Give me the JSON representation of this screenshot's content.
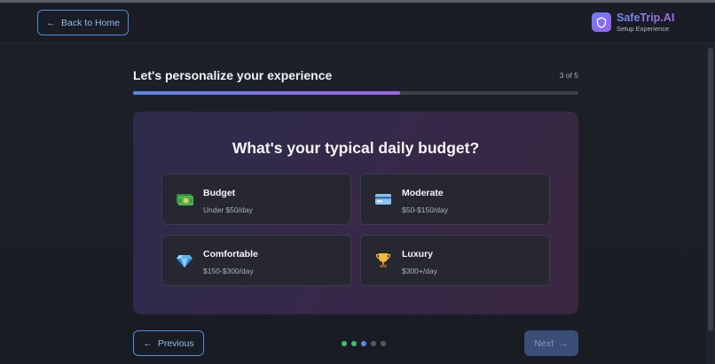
{
  "header": {
    "back_label": "Back to Home",
    "brand_name": "SafeTrip.AI",
    "brand_subtitle": "Setup Experience"
  },
  "wizard": {
    "title": "Let's personalize your experience",
    "step_text": "3 of 5",
    "progress_fraction": 0.6,
    "question": "What's your typical daily budget?",
    "options": [
      {
        "label": "Budget",
        "desc": "Under $50/day",
        "icon": "money-icon"
      },
      {
        "label": "Moderate",
        "desc": "$50-$150/day",
        "icon": "credit-card-icon"
      },
      {
        "label": "Comfortable",
        "desc": "$150-$300/day",
        "icon": "diamond-icon"
      },
      {
        "label": "Luxury",
        "desc": "$300+/day",
        "icon": "trophy-icon"
      }
    ]
  },
  "footer": {
    "previous_label": "Previous",
    "next_label": "Next",
    "dots": [
      {
        "state": "completed",
        "color": "#3fc06a"
      },
      {
        "state": "completed",
        "color": "#3fc06a"
      },
      {
        "state": "current",
        "color": "#4c8ef0"
      },
      {
        "state": "upcoming",
        "color": "#555a64"
      },
      {
        "state": "upcoming",
        "color": "#555a64"
      }
    ]
  },
  "colors": {
    "accent_blue": "#4e8fd6",
    "progress_start": "#5a86e8",
    "progress_end": "#a062e6"
  }
}
